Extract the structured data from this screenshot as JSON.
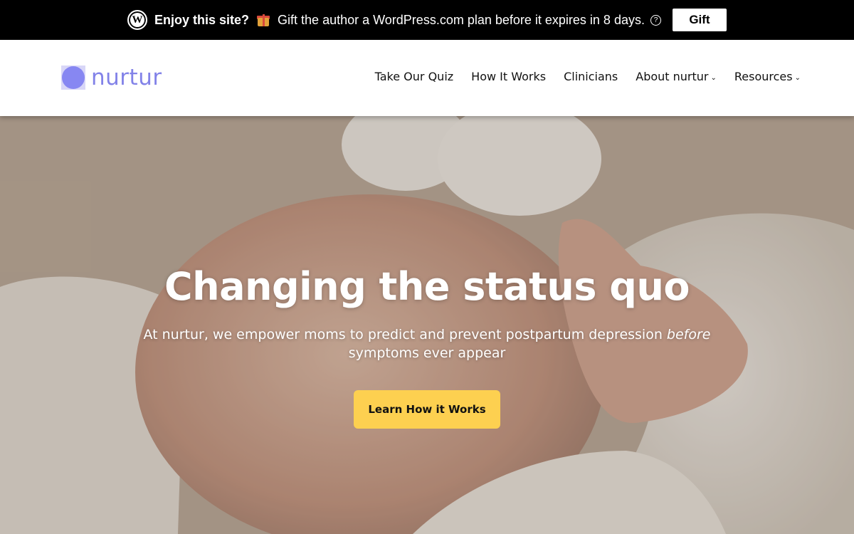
{
  "promo": {
    "lead": "Enjoy this site?",
    "message": "Gift the author a WordPress.com plan before it expires in 8 days.",
    "button": "Gift",
    "wp_icon": "W"
  },
  "header": {
    "logo_text": "nurtur",
    "nav": [
      {
        "label": "Take Our Quiz",
        "has_dropdown": false
      },
      {
        "label": "How It Works",
        "has_dropdown": false
      },
      {
        "label": "Clinicians",
        "has_dropdown": false
      },
      {
        "label": "About nurtur",
        "has_dropdown": true
      },
      {
        "label": "Resources",
        "has_dropdown": true
      }
    ],
    "chevron": "⌄"
  },
  "hero": {
    "title": "Changing the status quo",
    "subtitle_pre": "At nurtur, we empower moms to predict and prevent postpartum depression ",
    "subtitle_em": "before",
    "subtitle_post": " symptoms ever appear",
    "cta": "Learn How it Works"
  },
  "colors": {
    "promo_bg": "#000000",
    "brand": "#8282e8",
    "cta": "#fdd050"
  }
}
